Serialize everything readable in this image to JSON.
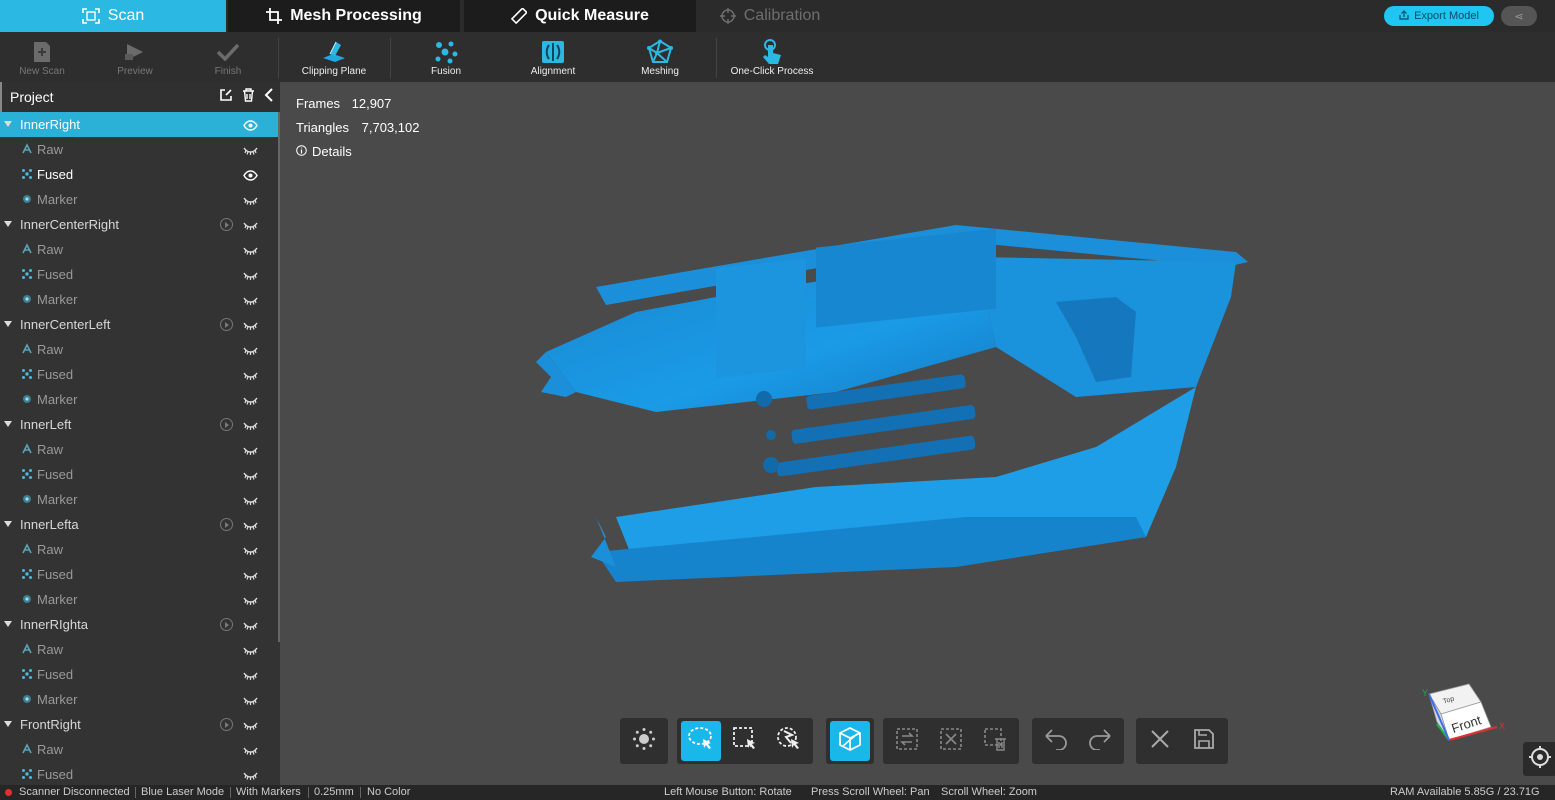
{
  "tabs": [
    {
      "label": "Scan",
      "icon": "scan-icon",
      "active": true
    },
    {
      "label": "Mesh Processing",
      "icon": "crop-icon"
    },
    {
      "label": "Quick Measure",
      "icon": "ruler-icon"
    },
    {
      "label": "Calibration",
      "icon": "crosshair-icon",
      "disabled": true
    }
  ],
  "header_actions": {
    "export_label": "Export Model",
    "share_label": "⋖"
  },
  "toolbar": {
    "new_scan": "New Scan",
    "preview": "Preview",
    "finish": "Finish",
    "clipping_plane": "Clipping Plane",
    "fusion": "Fusion",
    "alignment": "Alignment",
    "meshing": "Meshing",
    "one_click": "One-Click Process"
  },
  "sidebar": {
    "title": "Project",
    "groups": [
      {
        "name": "InnerRight",
        "selected": true,
        "children": [
          {
            "label": "Raw",
            "visible": false
          },
          {
            "label": "Fused",
            "visible": true
          },
          {
            "label": "Marker",
            "visible": false
          }
        ]
      },
      {
        "name": "InnerCenterRight",
        "children": [
          {
            "label": "Raw",
            "visible": false
          },
          {
            "label": "Fused",
            "visible": false
          },
          {
            "label": "Marker",
            "visible": false
          }
        ]
      },
      {
        "name": "InnerCenterLeft",
        "children": [
          {
            "label": "Raw",
            "visible": false
          },
          {
            "label": "Fused",
            "visible": false
          },
          {
            "label": "Marker",
            "visible": false
          }
        ]
      },
      {
        "name": "InnerLeft",
        "children": [
          {
            "label": "Raw",
            "visible": false
          },
          {
            "label": "Fused",
            "visible": false
          },
          {
            "label": "Marker",
            "visible": false
          }
        ]
      },
      {
        "name": "InnerLefta",
        "children": [
          {
            "label": "Raw",
            "visible": false
          },
          {
            "label": "Fused",
            "visible": false
          },
          {
            "label": "Marker",
            "visible": false
          }
        ]
      },
      {
        "name": "InnerRIghta",
        "children": [
          {
            "label": "Raw",
            "visible": false
          },
          {
            "label": "Fused",
            "visible": false
          },
          {
            "label": "Marker",
            "visible": false
          }
        ]
      },
      {
        "name": "FrontRight",
        "children": [
          {
            "label": "Raw",
            "visible": false
          },
          {
            "label": "Fused",
            "visible": false
          }
        ]
      }
    ]
  },
  "stats": {
    "frames_label": "Frames",
    "frames_value": "12,907",
    "triangles_label": "Triangles",
    "triangles_value": "7,703,102",
    "details_label": "Details"
  },
  "nav_cube": {
    "top": "Top",
    "front": "Front",
    "axis_x": "X",
    "axis_y": "Y"
  },
  "statusbar": {
    "scanner": "Scanner Disconnected",
    "mode": "Blue Laser Mode",
    "markers": "With Markers",
    "resolution": "0.25mm",
    "color": "No Color",
    "hint_rotate": "Left Mouse Button: Rotate",
    "hint_pan": "Press Scroll Wheel: Pan",
    "hint_zoom": "Scroll Wheel: Zoom",
    "ram": "RAM Available 5.85G / 23.71G"
  },
  "colors": {
    "accent": "#2bb8e3",
    "model": "#1e8fd6",
    "background": "#4a4a4a"
  }
}
